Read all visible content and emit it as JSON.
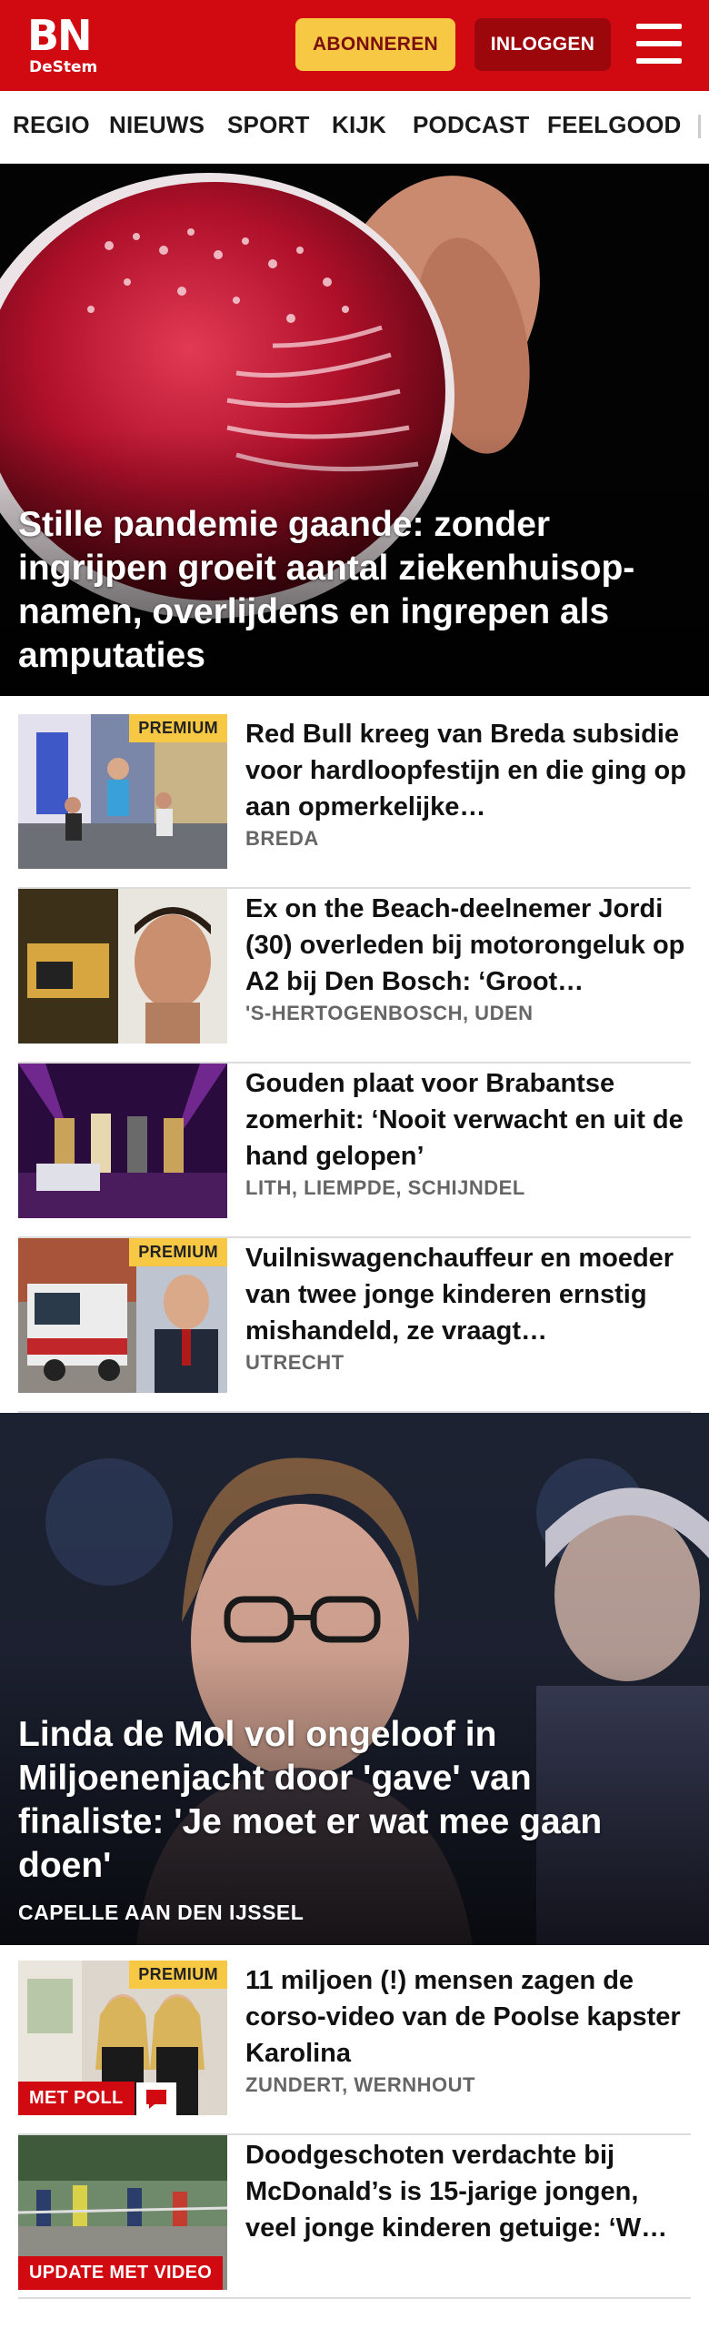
{
  "header": {
    "logo_main": "BN",
    "logo_sub": "DeStem",
    "subscribe_label": "ABONNEREN",
    "login_label": "INLOGGEN",
    "brand_color": "#d10a11",
    "accent_color": "#f7c844"
  },
  "nav": {
    "items": [
      "REGIO",
      "NIEUWS",
      "SPORT",
      "KIJK",
      "PODCAST",
      "FEELGOOD"
    ]
  },
  "hero1": {
    "title": "Stille pandemie gaande: zonder ingrijpen groeit aantal ziekenhuisop-namen, overlijdens en ingrepen als amputaties"
  },
  "articles": [
    {
      "title": "Red Bull kreeg van Breda subsidie voor hardloopfestijn en die ging op aan opmerkelijke…",
      "location": "BREDA",
      "badge": "PREMIUM"
    },
    {
      "title": "Ex on the Beach-deelnemer Jordi (30) overleden bij motorongeluk op A2 bij Den Bosch: ‘Groot…",
      "location": "'S-HERTOGENBOSCH, UDEN"
    },
    {
      "title": "Gouden plaat voor Brabantse zomerhit: ‘Nooit verwacht en uit de hand gelopen’",
      "location": "LITH, LIEMPDE, SCHIJNDEL"
    },
    {
      "title": "Vuilniswagenchauffeur en moeder van twee jonge kinderen ernstig mishandeld, ze vraagt…",
      "location": "UTRECHT",
      "badge": "PREMIUM"
    }
  ],
  "hero2": {
    "title": "Linda de Mol vol ongeloof in Miljoenenjacht door 'gave' van finaliste: 'Je moet er wat mee gaan doen'",
    "location": "CAPELLE AAN DEN IJSSEL"
  },
  "articles2": [
    {
      "title": "11 miljoen (!) mensen zagen de corso-video van de Poolse kapster Karolina",
      "location": "ZUNDERT, WERNHOUT",
      "badge": "PREMIUM",
      "tag": "MET POLL"
    },
    {
      "title": "Doodgeschoten verdachte bij McDonald’s is 15-jarige jongen, veel jonge kinderen getuige: ‘W…",
      "tag": "UPDATE MET VIDEO"
    }
  ]
}
